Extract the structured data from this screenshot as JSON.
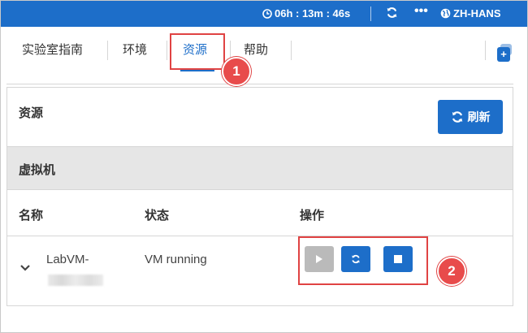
{
  "topbar": {
    "timer": "06h : 13m : 46s",
    "more_label": "•••",
    "language": "ZH-HANS",
    "icons": [
      "clock-icon",
      "refresh-icon",
      "more-icon",
      "globe-icon"
    ]
  },
  "tabs": [
    {
      "label": "实验室指南",
      "active": false
    },
    {
      "label": "环境",
      "active": false
    },
    {
      "label": "资源",
      "active": true
    },
    {
      "label": "帮助",
      "active": false
    }
  ],
  "panel": {
    "title": "资源",
    "refresh_label": "刷新",
    "section_title": "虚拟机",
    "columns": [
      "名称",
      "状态",
      "操作"
    ],
    "rows": [
      {
        "name": "LabVM-",
        "status": "VM running",
        "actions": [
          "start",
          "restart",
          "stop"
        ]
      }
    ]
  },
  "annotations": [
    "1",
    "2"
  ],
  "colors": {
    "accent": "#1d6ec9",
    "annotation": "#e04343",
    "header_bg": "#e6e6e6",
    "disabled": "#aaaaaa"
  }
}
